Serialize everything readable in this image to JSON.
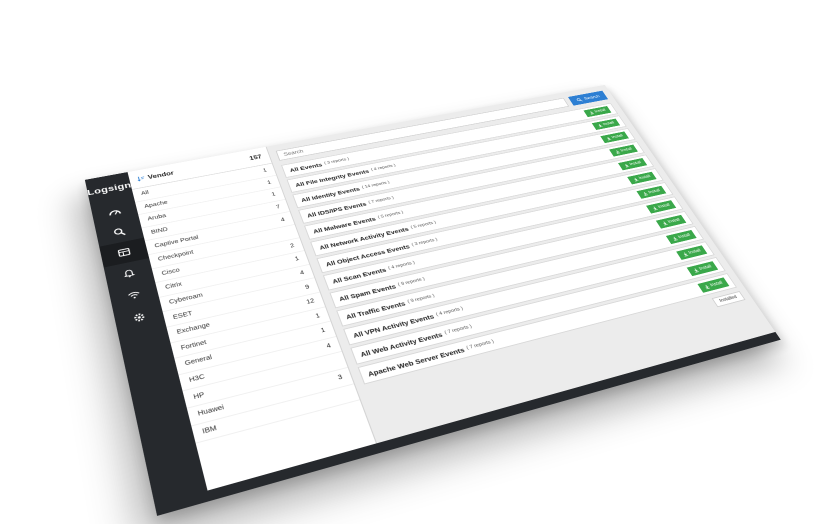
{
  "app": {
    "logo": "Logsign"
  },
  "nav": [
    {
      "name": "dashboard-icon"
    },
    {
      "name": "search-icon"
    },
    {
      "name": "apps-icon"
    },
    {
      "name": "bell-icon"
    },
    {
      "name": "wifi-icon"
    },
    {
      "name": "gear-icon"
    }
  ],
  "vendor": {
    "title": "Vendor",
    "total": "157",
    "items": [
      {
        "name": "All",
        "count": "1"
      },
      {
        "name": "Apache",
        "count": "1"
      },
      {
        "name": "Aruba",
        "count": "1"
      },
      {
        "name": "BIND",
        "count": "7"
      },
      {
        "name": "Captive Portal",
        "count": "4"
      },
      {
        "name": "Checkpoint",
        "count": ""
      },
      {
        "name": "Cisco",
        "count": "2"
      },
      {
        "name": "Citrix",
        "count": "1"
      },
      {
        "name": "Cyberoam",
        "count": "4"
      },
      {
        "name": "ESET",
        "count": "9"
      },
      {
        "name": "Exchange",
        "count": "12"
      },
      {
        "name": "Fortinet",
        "count": "1"
      },
      {
        "name": "General",
        "count": "1"
      },
      {
        "name": "H3C",
        "count": "4"
      },
      {
        "name": "HP",
        "count": ""
      },
      {
        "name": "Huawei",
        "count": "3"
      },
      {
        "name": "IBM",
        "count": ""
      }
    ]
  },
  "search": {
    "placeholder": "Search",
    "button_label": "Search"
  },
  "events": {
    "install_label": "Install",
    "installed_label": "Installed",
    "items": [
      {
        "name": "All Events",
        "count": "( 3 reports )"
      },
      {
        "name": "All File Integrity Events",
        "count": "( 4 reports )"
      },
      {
        "name": "All Identity Events",
        "count": "( 14 reports )"
      },
      {
        "name": "All IDS/IPS Events",
        "count": "( 7 reports )"
      },
      {
        "name": "All Malware Events",
        "count": "( 5 reports )"
      },
      {
        "name": "All Network Activity Events",
        "count": "( 5 reports )"
      },
      {
        "name": "All Object Access Events",
        "count": "( 3 reports )"
      },
      {
        "name": "All Scan Events",
        "count": "( 4 reports )"
      },
      {
        "name": "All Spam Events",
        "count": "( 9 reports )"
      },
      {
        "name": "All Traffic Events",
        "count": "( 9 reports )"
      },
      {
        "name": "All VPN Activity Events",
        "count": "( 4 reports )"
      },
      {
        "name": "All Web Activity Events",
        "count": "( 7 reports )"
      },
      {
        "name": "Apache Web Server Events",
        "count": "( 7 reports )"
      }
    ]
  },
  "colors": {
    "sidebar": "#26292d",
    "search_button": "#2d7fd3",
    "install_button": "#3aa84a"
  }
}
